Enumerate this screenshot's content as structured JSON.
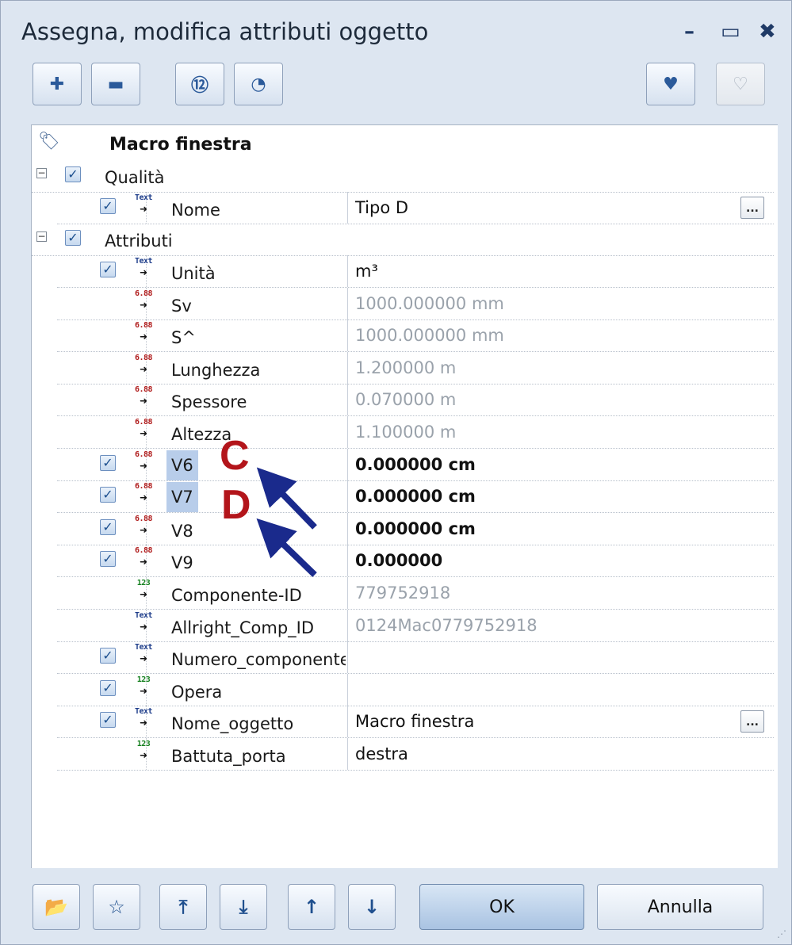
{
  "window": {
    "title": "Assegna, modifica attributi oggetto",
    "minimize": "–",
    "maximize": "▭",
    "close": "✖"
  },
  "toolbar": {
    "buttons": [
      {
        "icon": "add-attribute-icon",
        "glyph": "✚"
      },
      {
        "icon": "remove-attribute-icon",
        "glyph": "▬"
      },
      {
        "icon": "number-view-icon",
        "glyph": "⑫"
      },
      {
        "icon": "color-view-icon",
        "glyph": "◔"
      },
      {
        "icon": "favorite-add-icon",
        "glyph": "♥"
      },
      {
        "icon": "favorite-remove-icon",
        "glyph": "♡"
      }
    ]
  },
  "header": {
    "tag_glyph": "🏷",
    "title": "Macro finestra"
  },
  "groups": [
    {
      "label": "Qualità",
      "expander": "−",
      "checked": true
    },
    {
      "label": "Attributi",
      "expander": "−",
      "checked": true
    }
  ],
  "rows": [
    {
      "checked": true,
      "type_label": "Text",
      "type": "text",
      "name": "Nome",
      "value": "Tipo D",
      "grey": false,
      "bold": false,
      "ellipsis": "..."
    },
    {
      "checked": true,
      "type_label": "Text",
      "type": "text",
      "name": "Unità",
      "value": "m³",
      "grey": false,
      "bold": false
    },
    {
      "checked": false,
      "type_label": "6.88",
      "type": "num",
      "name": "Sv",
      "value": "1000.000000 mm",
      "grey": true,
      "bold": false
    },
    {
      "checked": false,
      "type_label": "6.88",
      "type": "num",
      "name": "S^",
      "value": "1000.000000 mm",
      "grey": true,
      "bold": false
    },
    {
      "checked": false,
      "type_label": "6.88",
      "type": "num",
      "name": "Lunghezza",
      "value": "1.200000 m",
      "grey": true,
      "bold": false
    },
    {
      "checked": false,
      "type_label": "6.88",
      "type": "num",
      "name": "Spessore",
      "value": "0.070000 m",
      "grey": true,
      "bold": false
    },
    {
      "checked": false,
      "type_label": "6.88",
      "type": "num",
      "name": "Altezza",
      "value": "1.100000 m",
      "grey": true,
      "bold": false
    },
    {
      "checked": true,
      "type_label": "6.88",
      "type": "num",
      "name": "V6",
      "value": "0.000000 cm",
      "grey": false,
      "bold": true,
      "highlight": true
    },
    {
      "checked": true,
      "type_label": "6.88",
      "type": "num",
      "name": "V7",
      "value": "0.000000 cm",
      "grey": false,
      "bold": true,
      "highlight": true
    },
    {
      "checked": true,
      "type_label": "6.88",
      "type": "num",
      "name": "V8",
      "value": "0.000000 cm",
      "grey": false,
      "bold": true
    },
    {
      "checked": true,
      "type_label": "6.88",
      "type": "num",
      "name": "V9",
      "value": "0.000000",
      "grey": false,
      "bold": true
    },
    {
      "checked": false,
      "type_label": "123",
      "type": "int",
      "name": "Componente-ID",
      "value": "779752918",
      "grey": true,
      "bold": false
    },
    {
      "checked": false,
      "type_label": "Text",
      "type": "text",
      "name": "Allright_Comp_ID",
      "value": "0124Mac0779752918",
      "grey": true,
      "bold": false
    },
    {
      "checked": true,
      "type_label": "Text",
      "type": "text",
      "name": "Numero_componente",
      "value": "",
      "grey": false,
      "bold": false
    },
    {
      "checked": true,
      "type_label": "123",
      "type": "int",
      "name": "Opera",
      "value": "",
      "grey": false,
      "bold": false
    },
    {
      "checked": true,
      "type_label": "Text",
      "type": "text",
      "name": "Nome_oggetto",
      "value": "Macro finestra",
      "grey": false,
      "bold": false,
      "ellipsis": "..."
    },
    {
      "checked": false,
      "type_label": "123",
      "type": "int",
      "name": "Battuta_porta",
      "value": "destra",
      "grey": false,
      "bold": false
    }
  ],
  "annotations": {
    "letter_c": "C",
    "letter_d": "D",
    "arrow_color": "#1a2a8c",
    "letter_color": "#b3151b"
  },
  "bottom": {
    "buttons": [
      {
        "icon": "open-favorite-icon",
        "glyph": "📂"
      },
      {
        "icon": "save-favorite-icon",
        "glyph": "☆"
      },
      {
        "icon": "move-top-icon",
        "glyph": "⤒"
      },
      {
        "icon": "move-bottom-icon",
        "glyph": "⤓"
      },
      {
        "icon": "move-up-icon",
        "glyph": "↑"
      },
      {
        "icon": "move-down-icon",
        "glyph": "↓"
      }
    ],
    "ok_label": "OK",
    "cancel_label": "Annulla",
    "grip": "⋰"
  }
}
